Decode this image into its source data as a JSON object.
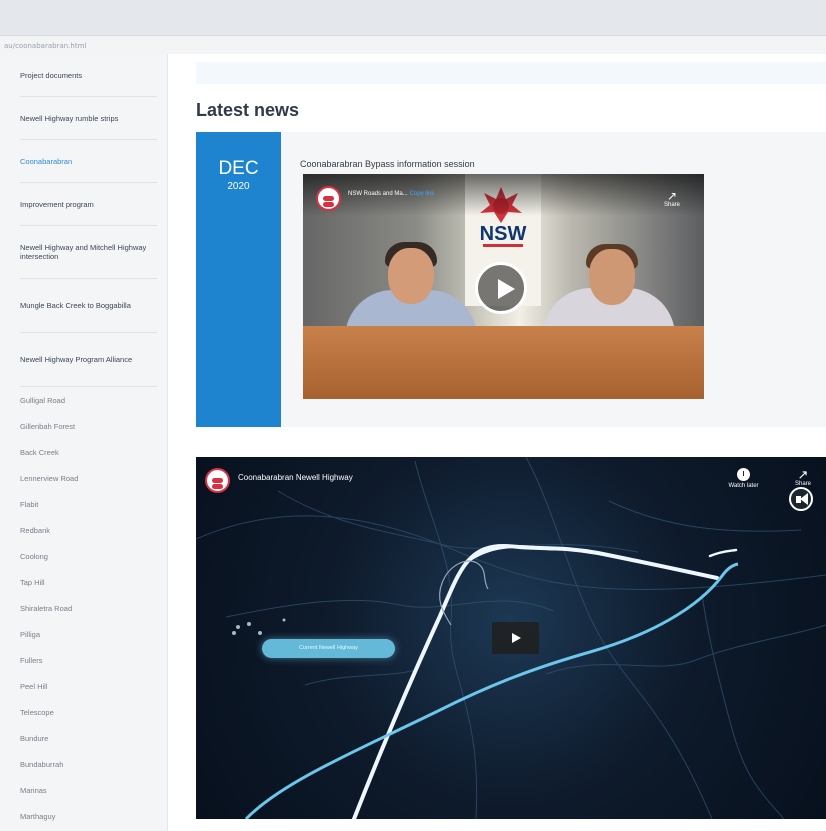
{
  "browser": {
    "url": "au/coonabarabran.html"
  },
  "sidebar": {
    "items": [
      {
        "label": "Project documents",
        "type": "major"
      },
      {
        "label": "Newell Highway rumble strips",
        "type": "major"
      },
      {
        "label": "Coonabarabran",
        "type": "active"
      },
      {
        "label": "Improvement program",
        "type": "major"
      },
      {
        "label": "Newell Highway and Mitchell Highway intersection",
        "type": "major"
      },
      {
        "label": "Mungle Back Creek to Boggabilla",
        "type": "major"
      },
      {
        "label": "Newell Highway Program Alliance",
        "type": "major"
      },
      {
        "label": "Gulligal Road",
        "type": "minor"
      },
      {
        "label": "Gillenbah Forest",
        "type": "minor"
      },
      {
        "label": "Back Creek",
        "type": "minor"
      },
      {
        "label": "Lennerview Road",
        "type": "minor"
      },
      {
        "label": "Flabit",
        "type": "minor"
      },
      {
        "label": "Redbank",
        "type": "minor"
      },
      {
        "label": "Coolong",
        "type": "minor"
      },
      {
        "label": "Tap Hill",
        "type": "minor"
      },
      {
        "label": "Shiraletra Road",
        "type": "minor"
      },
      {
        "label": "Pilliga",
        "type": "minor"
      },
      {
        "label": "Fullers",
        "type": "minor"
      },
      {
        "label": "Peel Hill",
        "type": "minor"
      },
      {
        "label": "Telescope",
        "type": "minor"
      },
      {
        "label": "Bundure",
        "type": "minor"
      },
      {
        "label": "Bundaburrah",
        "type": "minor"
      },
      {
        "label": "Marinas",
        "type": "minor"
      },
      {
        "label": "Marthaguy",
        "type": "minor"
      }
    ]
  },
  "main": {
    "heading": "Latest news",
    "news_card": {
      "month": "DEC",
      "year": "2020",
      "title": "Coonabarabran Bypass information session",
      "video": {
        "channel": "NSW Roads and Ma...",
        "subscribe": "Copy link",
        "share": "Share",
        "banner": "NSW",
        "play_icon": "play-icon"
      }
    },
    "second_video": {
      "title": "Coonabarabran Newell Highway",
      "watch_later": "Watch later",
      "share": "Share",
      "highway_label": "Current Newell Highway",
      "play_icon": "play-icon"
    }
  },
  "colors": {
    "accent": "#1e84cf",
    "map_light": "#eef7ff",
    "map_blue": "#6bc6e9"
  }
}
